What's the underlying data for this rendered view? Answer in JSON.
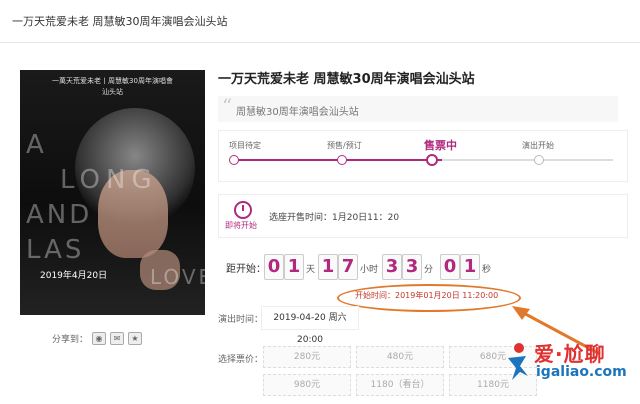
{
  "breadcrumb": "一万天荒爱未老 周慧敏30周年演唱会汕头站",
  "poster": {
    "top_text": "一萬天荒爱未老丨周慧敏30周年演唱會\n汕头站",
    "big_letters": [
      "A",
      "LONG",
      "AND",
      "LAS",
      "LOVE"
    ],
    "date": "2019年4月20日"
  },
  "share_label": "分享到：",
  "share_icons": [
    "weibo-icon",
    "wechat-icon",
    "favorite-icon"
  ],
  "title": "一万天荒爱未老 周慧敏30周年演唱会汕头站",
  "subtitle": "周慧敏30周年演唱会汕头站",
  "steps": [
    {
      "label": "项目待定",
      "state": "done"
    },
    {
      "label": "预售/预订",
      "state": "done"
    },
    {
      "label": "售票中",
      "state": "active"
    },
    {
      "label": "演出开始",
      "state": "pending"
    }
  ],
  "progress_fraction": 0.55,
  "start_status_label": "即将开始",
  "presale_text": "选座开售时间：1月20日11：20",
  "countdown": {
    "label": "距开始：",
    "days": "01",
    "days_unit": "天",
    "hours": "17",
    "hours_unit": "小时",
    "minutes": "33",
    "minutes_unit": "分",
    "seconds": "01",
    "seconds_unit": "秒"
  },
  "start_time_text": "开始时间：2019年01月20日 11:20:00",
  "performance": {
    "label": "演出时间：",
    "value": "2019-04-20 周六 20:00"
  },
  "price": {
    "label": "选择票价：",
    "options": [
      "280元",
      "480元",
      "680元",
      "980元",
      "1180（看台）",
      "1180元"
    ]
  },
  "watermark": {
    "brand": "爱·尬聊",
    "site": "igaliao.com"
  },
  "colors": {
    "accent": "#b0297e",
    "highlight": "#e1792a"
  }
}
